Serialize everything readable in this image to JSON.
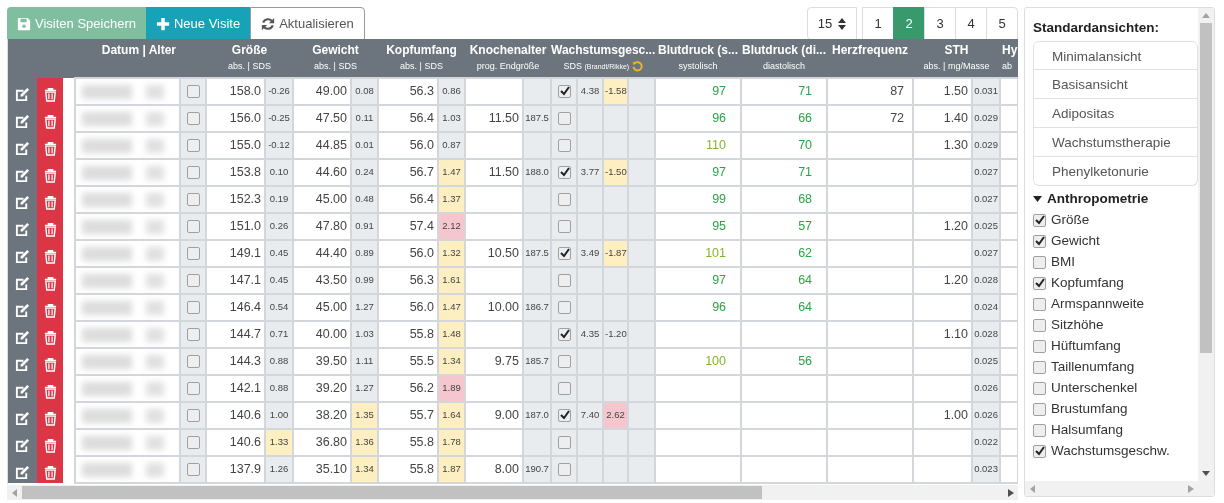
{
  "toolbar": {
    "buttons": [
      {
        "kind": "save",
        "label": "Visiten Speichern",
        "disabled": true
      },
      {
        "kind": "add",
        "label": "Neue Visite",
        "disabled": false
      },
      {
        "kind": "refresh",
        "label": "Aktualisieren",
        "disabled": false
      }
    ]
  },
  "pagination": {
    "page_size": "15",
    "pages": [
      {
        "label": "1",
        "selected": false
      },
      {
        "label": "2",
        "selected": true
      },
      {
        "label": "3",
        "selected": false
      },
      {
        "label": "4",
        "selected": false
      },
      {
        "label": "5",
        "selected": false
      }
    ]
  },
  "table": {
    "columns": [
      {
        "kind": "date",
        "title": "Datum | Alter"
      },
      {
        "kind": "groesse",
        "title": "Größe",
        "subtitle": "abs. | SDS"
      },
      {
        "kind": "gewicht",
        "title": "Gewicht",
        "subtitle": "abs. | SDS"
      },
      {
        "kind": "kopf",
        "title": "Kopfumfang",
        "subtitle": "abs. | SDS"
      },
      {
        "kind": "knochen",
        "title": "Knochenalter",
        "subtitle": "prog. Endgröße"
      },
      {
        "kind": "wachstum",
        "title": "Wachstumsgesc...",
        "subtitle": "SDS",
        "subnote": "(Brandt/Rikke)"
      },
      {
        "kind": "bps",
        "title": "Blutdruck (s...",
        "subtitle": "systolisch"
      },
      {
        "kind": "bpd",
        "title": "Blutdruck (di...",
        "subtitle": "diastolisch"
      },
      {
        "kind": "hf",
        "title": "Herzfrequenz"
      },
      {
        "kind": "sth",
        "title": "STH",
        "subtitle": "abs. | mg/Masse"
      },
      {
        "kind": "hy",
        "title": "Hy",
        "subtitle": "ab"
      }
    ],
    "rows": [
      {
        "selected": false,
        "groesse": "158.0",
        "groesse_sds": "-0.26",
        "gewicht": "49.00",
        "gewicht_sds": "0.08",
        "kopf": "56.3",
        "kopf_sds": "0.86",
        "wachstum_checked": true,
        "wachstum": "4.38",
        "wachstum_sds": {
          "text": "-1.58",
          "color": "#fdefc2"
        },
        "bps": "97",
        "bpd": "71",
        "hf": "87",
        "sth": "1.50",
        "sth_mg": "0.031"
      },
      {
        "selected": false,
        "groesse": "156.0",
        "groesse_sds": "-0.25",
        "gewicht": "47.50",
        "gewicht_sds": "0.11",
        "kopf": "56.4",
        "kopf_sds": "1.03",
        "knochen": "11.50",
        "knochen_end": "187.5",
        "wachstum_checked": false,
        "bps": "96",
        "bpd": "66",
        "hf": "72",
        "sth": "1.40",
        "sth_mg": "0.029"
      },
      {
        "selected": false,
        "groesse": "155.0",
        "groesse_sds": "-0.12",
        "gewicht": "44.85",
        "gewicht_sds": "0.01",
        "kopf": "56.0",
        "kopf_sds": "0.87",
        "wachstum_checked": false,
        "bps": {
          "text": "110",
          "color": "#85b52a"
        },
        "bpd": "70",
        "sth": "1.30",
        "sth_mg": "0.029"
      },
      {
        "selected": false,
        "groesse": "153.8",
        "groesse_sds": "0.10",
        "gewicht": "44.60",
        "gewicht_sds": "0.24",
        "kopf": "56.7",
        "kopf_sds": {
          "text": "1.47",
          "color": "#fdefc2"
        },
        "knochen": "11.50",
        "knochen_end": "188.0",
        "wachstum_checked": true,
        "wachstum": "3.77",
        "wachstum_sds": {
          "text": "-1.50",
          "color": "#fdefc2"
        },
        "bps": "97",
        "bpd": "71",
        "sth_mg": "0.027"
      },
      {
        "selected": false,
        "groesse": "152.3",
        "groesse_sds": "0.19",
        "gewicht": "45.00",
        "gewicht_sds": "0.48",
        "kopf": "56.4",
        "kopf_sds": {
          "text": "1.37",
          "color": "#fdefc2"
        },
        "wachstum_checked": false,
        "bps": "99",
        "bpd": "68",
        "sth_mg": "0.027"
      },
      {
        "selected": false,
        "groesse": "151.0",
        "groesse_sds": "0.26",
        "gewicht": "47.80",
        "gewicht_sds": "0.91",
        "kopf": "57.4",
        "kopf_sds": {
          "text": "2.12",
          "color": "#f5c6cd"
        },
        "wachstum_checked": false,
        "bps": "95",
        "bpd": "57",
        "sth": "1.20",
        "sth_mg": "0.025"
      },
      {
        "selected": false,
        "groesse": "149.1",
        "groesse_sds": "0.45",
        "gewicht": "44.40",
        "gewicht_sds": "0.89",
        "kopf": "56.0",
        "kopf_sds": {
          "text": "1.32",
          "color": "#fdefc2"
        },
        "knochen": "10.50",
        "knochen_end": "187.5",
        "wachstum_checked": true,
        "wachstum": "3.49",
        "wachstum_sds": {
          "text": "-1.87",
          "color": "#fdefc2"
        },
        "bps": {
          "text": "101",
          "color": "#85b52a"
        },
        "bpd": "62",
        "sth_mg": "0.027"
      },
      {
        "selected": false,
        "groesse": "147.1",
        "groesse_sds": "0.45",
        "gewicht": "43.50",
        "gewicht_sds": "0.99",
        "kopf": "56.3",
        "kopf_sds": {
          "text": "1.61",
          "color": "#fdefc2"
        },
        "wachstum_checked": false,
        "bps": "97",
        "bpd": "64",
        "sth": "1.20",
        "sth_mg": "0.028"
      },
      {
        "selected": false,
        "groesse": "146.4",
        "groesse_sds": "0.54",
        "gewicht": "45.00",
        "gewicht_sds": "1.27",
        "kopf": "56.0",
        "kopf_sds": {
          "text": "1.47",
          "color": "#fdefc2"
        },
        "knochen": "10.00",
        "knochen_end": "186.7",
        "wachstum_checked": false,
        "bps": "96",
        "bpd": "64",
        "sth_mg": "0.024"
      },
      {
        "selected": false,
        "groesse": "144.7",
        "groesse_sds": "0.71",
        "gewicht": "40.00",
        "gewicht_sds": "1.03",
        "kopf": "55.8",
        "kopf_sds": {
          "text": "1.48",
          "color": "#fdefc2"
        },
        "wachstum_checked": true,
        "wachstum": "4.35",
        "wachstum_sds": "-1.20",
        "sth": "1.10",
        "sth_mg": "0.028"
      },
      {
        "selected": false,
        "groesse": "144.3",
        "groesse_sds": "0.88",
        "gewicht": "39.50",
        "gewicht_sds": "1.11",
        "kopf": "55.5",
        "kopf_sds": {
          "text": "1.34",
          "color": "#fdefc2"
        },
        "knochen": "9.75",
        "knochen_end": "185.7",
        "wachstum_checked": false,
        "bps": {
          "text": "100",
          "color": "#85b52a"
        },
        "bpd": "56",
        "sth_mg": "0.025"
      },
      {
        "selected": false,
        "groesse": "142.1",
        "groesse_sds": "0.88",
        "gewicht": "39.20",
        "gewicht_sds": "1.27",
        "kopf": "56.2",
        "kopf_sds": {
          "text": "1.89",
          "color": "#f5c6cd"
        },
        "wachstum_checked": false,
        "sth_mg": "0.026"
      },
      {
        "selected": false,
        "groesse": "140.6",
        "groesse_sds": "1.00",
        "gewicht": "38.20",
        "gewicht_sds": {
          "text": "1.35",
          "color": "#fdefc2"
        },
        "kopf": "55.7",
        "kopf_sds": {
          "text": "1.64",
          "color": "#fdefc2"
        },
        "knochen": "9.00",
        "knochen_end": "187.0",
        "wachstum_checked": true,
        "wachstum": "7.40",
        "wachstum_sds": {
          "text": "2.62",
          "color": "#f5c6cd"
        },
        "sth": "1.00",
        "sth_mg": "0.026"
      },
      {
        "selected": false,
        "groesse": "140.6",
        "groesse_sds": {
          "text": "1.33",
          "color": "#fdefc2"
        },
        "gewicht": "36.80",
        "gewicht_sds": {
          "text": "1.36",
          "color": "#fdefc2"
        },
        "kopf": "55.8",
        "kopf_sds": {
          "text": "1.78",
          "color": "#fdefc2"
        },
        "wachstum_checked": false,
        "sth_mg": "0.022"
      },
      {
        "selected": false,
        "groesse": "137.9",
        "groesse_sds": "1.26",
        "gewicht": "35.10",
        "gewicht_sds": {
          "text": "1.34",
          "color": "#fdefc2"
        },
        "kopf": "55.8",
        "kopf_sds": {
          "text": "1.87",
          "color": "#fdefc2"
        },
        "knochen": "8.00",
        "knochen_end": "190.7",
        "wachstum_checked": false,
        "sth_mg": "0.023"
      }
    ]
  },
  "sidebar": {
    "views_title": "Standardansichten:",
    "views": [
      "Minimalansicht",
      "Basisansicht",
      "Adipositas",
      "Wachstumstherapie",
      "Phenylketonurie"
    ],
    "groups": [
      {
        "title": "Anthropometrie",
        "expanded": true,
        "items": [
          {
            "label": "Größe",
            "checked": true
          },
          {
            "label": "Gewicht",
            "checked": true
          },
          {
            "label": "BMI",
            "checked": false
          },
          {
            "label": "Kopfumfang",
            "checked": true
          },
          {
            "label": "Armspannweite",
            "checked": false
          },
          {
            "label": "Sitzhöhe",
            "checked": false
          },
          {
            "label": "Hüftumfang",
            "checked": false
          },
          {
            "label": "Taillenumfang",
            "checked": false
          },
          {
            "label": "Unterschenkel",
            "checked": false
          },
          {
            "label": "Brustumfang",
            "checked": false
          },
          {
            "label": "Halsumfang",
            "checked": false
          },
          {
            "label": "Wachstumsgeschw.",
            "checked": true
          }
        ]
      }
    ]
  }
}
